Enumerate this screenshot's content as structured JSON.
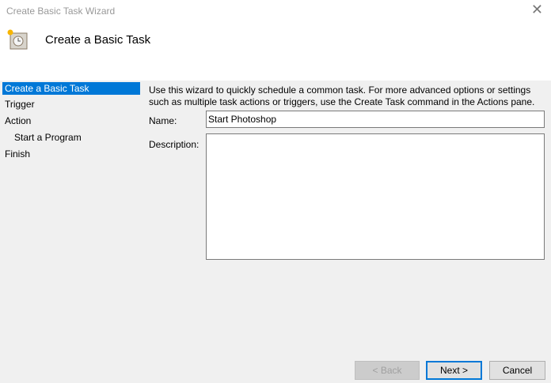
{
  "window": {
    "title": "Create Basic Task Wizard",
    "header": "Create a Basic Task"
  },
  "sidebar": {
    "items": [
      {
        "label": "Create a Basic Task"
      },
      {
        "label": "Trigger"
      },
      {
        "label": "Action"
      },
      {
        "label": "Start a Program"
      },
      {
        "label": "Finish"
      }
    ]
  },
  "main": {
    "intro": "Use this wizard to quickly schedule a common task.  For more advanced options or settings such as multiple task actions or triggers, use the Create Task command in the Actions pane.",
    "name_label": "Name:",
    "name_value": "Start Photoshop",
    "description_label": "Description:",
    "description_value": ""
  },
  "buttons": {
    "back": "< Back",
    "next": "Next >",
    "cancel": "Cancel"
  },
  "colors": {
    "accent": "#0078d7"
  }
}
